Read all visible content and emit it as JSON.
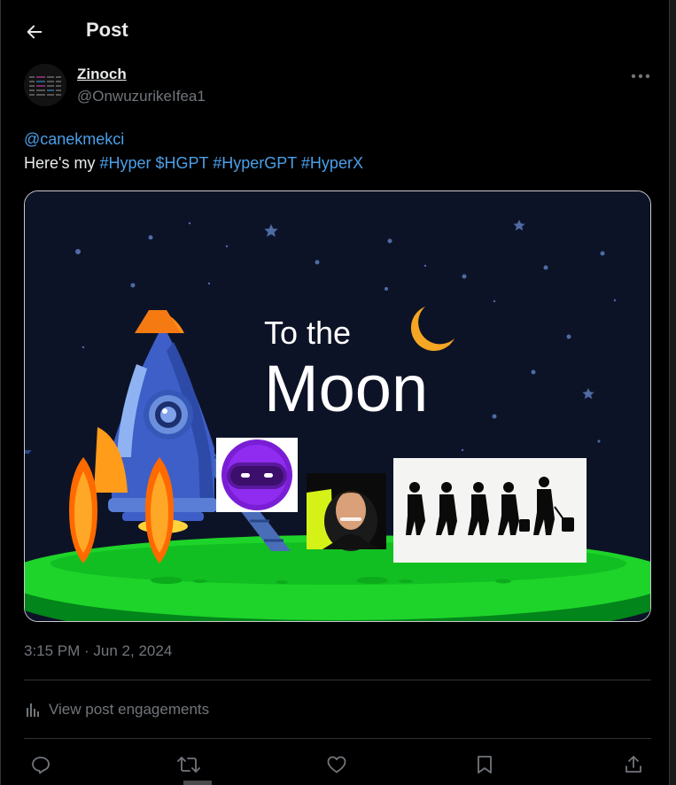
{
  "header": {
    "title": "Post"
  },
  "author": {
    "name": "Zinoch",
    "handle": "@OnwuzurikeIfea1"
  },
  "post": {
    "mention": "@canekmekci",
    "prefix": "Here's my ",
    "tags": [
      "#Hyper",
      "$HGPT",
      "#HyperGPT",
      "#HyperX"
    ]
  },
  "media": {
    "line1": "To the",
    "line2": "Moon"
  },
  "timestamp": "3:15 PM · Jun 2, 2024",
  "engagements_label": "View post engagements",
  "colors": {
    "link": "#4b9fe8",
    "muted": "#71767b",
    "moon": "#f5a623",
    "grass": "#1ed42a"
  }
}
